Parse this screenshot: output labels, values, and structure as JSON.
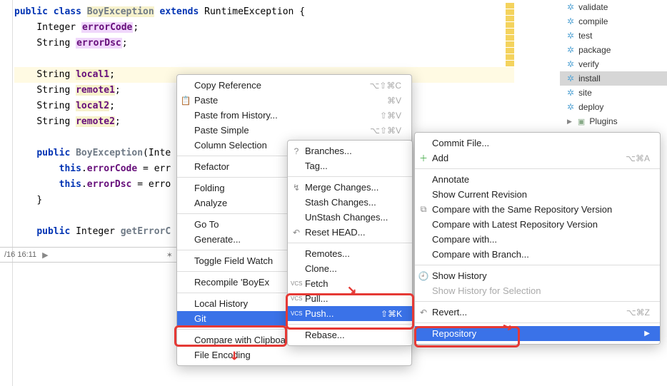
{
  "code": {
    "l1_kw1": "public",
    "l1_kw2": "class",
    "l1_cls": "BoyException",
    "l1_kw3": "extends",
    "l1_sup": "RuntimeException",
    "l1_b": "{",
    "l2_t": "Integer",
    "l2_f": "errorCode",
    "l2_e": ";",
    "l3_t": "String",
    "l3_f": "errorDsc",
    "l3_e": ";",
    "l5_t": "String",
    "l5_f": "local1",
    "l5_e": ";",
    "l6_t": "String",
    "l6_f": "remote1",
    "l6_e": ";",
    "l7_t": "String",
    "l7_f": "local2",
    "l7_e": ";",
    "l8_t": "String",
    "l8_f": "remote2",
    "l8_e": ";",
    "l10_kw": "public",
    "l10_cls": "BoyException",
    "l10_p": "(Inte",
    "l11_this": "this",
    "l11_dot": ".",
    "l11_f": "errorCode",
    "l11_rest": " = err",
    "l12_this": "this",
    "l12_dot": ".",
    "l12_f": "errorDsc",
    "l12_rest": " = erro",
    "l13": "}",
    "l15_kw": "public",
    "l15_t": "Integer",
    "l15_m": "getErrorC"
  },
  "status": {
    "time": "/16 16:11"
  },
  "side": {
    "items": [
      "validate",
      "compile",
      "test",
      "package",
      "verify",
      "install",
      "site",
      "deploy"
    ],
    "selectedIndex": 5,
    "plugins": "Plugins"
  },
  "menu1": {
    "copyRef": "Copy Reference",
    "copyRef_sc": "⌥⇧⌘C",
    "paste": "Paste",
    "paste_sc": "⌘V",
    "pasteHist": "Paste from History...",
    "pasteHist_sc": "⇧⌘V",
    "pasteSimple": "Paste Simple",
    "pasteSimple_sc": "⌥⇧⌘V",
    "colSel": "Column Selection",
    "refactor": "Refactor",
    "folding": "Folding",
    "analyze": "Analyze",
    "goto": "Go To",
    "generate": "Generate...",
    "toggleFW": "Toggle Field Watch",
    "recompile": "Recompile 'BoyEx",
    "localHist": "Local History",
    "git": "Git",
    "compareClip": "Compare with Clipboard",
    "fileEnc": "File Encoding"
  },
  "menu2": {
    "branches": "Branches...",
    "tag": "Tag...",
    "merge": "Merge Changes...",
    "stash": "Stash Changes...",
    "unstash": "UnStash Changes...",
    "reset": "Reset HEAD...",
    "remotes": "Remotes...",
    "clone": "Clone...",
    "fetch": "Fetch",
    "pull": "Pull...",
    "push": "Push...",
    "push_sc": "⇧⌘K",
    "rebase": "Rebase..."
  },
  "menu3": {
    "commit": "Commit File...",
    "add": "Add",
    "add_sc": "⌥⌘A",
    "annotate": "Annotate",
    "showCur": "Show Current Revision",
    "cmpSame": "Compare with the Same Repository Version",
    "cmpLatest": "Compare with Latest Repository Version",
    "cmpWith": "Compare with...",
    "cmpBranch": "Compare with Branch...",
    "showHist": "Show History",
    "showHistSel": "Show History for Selection",
    "revert": "Revert...",
    "revert_sc": "⌥⌘Z",
    "repo": "Repository"
  }
}
